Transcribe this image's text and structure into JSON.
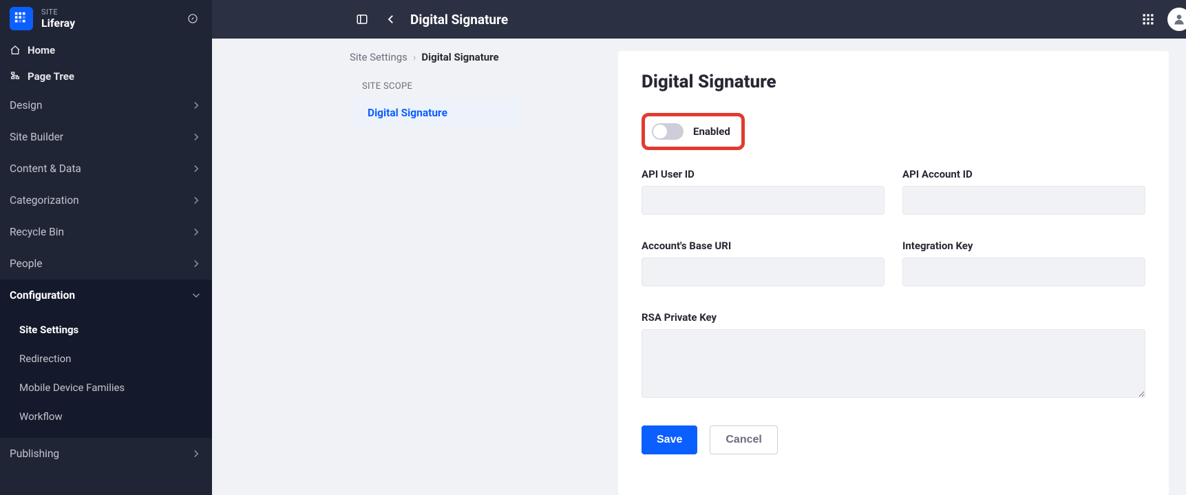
{
  "sidebar": {
    "site_type_label": "SITE",
    "site_name": "Liferay",
    "home": "Home",
    "page_tree": "Page Tree",
    "groups": [
      {
        "label": "Design"
      },
      {
        "label": "Site Builder"
      },
      {
        "label": "Content & Data"
      },
      {
        "label": "Categorization"
      },
      {
        "label": "Recycle Bin"
      },
      {
        "label": "People"
      },
      {
        "label": "Configuration",
        "expanded": true
      },
      {
        "label": "Publishing"
      }
    ],
    "config_children": [
      {
        "label": "Site Settings",
        "active": true
      },
      {
        "label": "Redirection"
      },
      {
        "label": "Mobile Device Families"
      },
      {
        "label": "Workflow"
      }
    ]
  },
  "topbar": {
    "title": "Digital Signature"
  },
  "breadcrumb": {
    "root": "Site Settings",
    "current": "Digital Signature"
  },
  "scope": {
    "heading": "SITE SCOPE",
    "item": "Digital Signature"
  },
  "form": {
    "title": "Digital Signature",
    "enabled_label": "Enabled",
    "fields": {
      "api_user_id": "API User ID",
      "api_account_id": "API Account ID",
      "base_uri": "Account's Base URI",
      "integration_key": "Integration Key",
      "rsa_key": "RSA Private Key"
    },
    "save": "Save",
    "cancel": "Cancel"
  }
}
